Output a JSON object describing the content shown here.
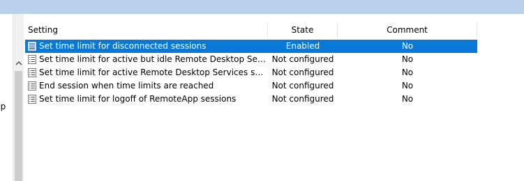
{
  "left_pane": {
    "clipped_text": "pp"
  },
  "table": {
    "columns": {
      "setting": "Setting",
      "state": "State",
      "comment": "Comment"
    },
    "rows": [
      {
        "name": "Set time limit for disconnected sessions",
        "state": "Enabled",
        "comment": "No",
        "selected": true
      },
      {
        "name": "Set time limit for active but idle Remote Desktop Services se...",
        "state": "Not configured",
        "comment": "No",
        "selected": false
      },
      {
        "name": "Set time limit for active Remote Desktop Services sessions",
        "state": "Not configured",
        "comment": "No",
        "selected": false
      },
      {
        "name": "End session when time limits are reached",
        "state": "Not configured",
        "comment": "No",
        "selected": false
      },
      {
        "name": "Set time limit for logoff of RemoteApp sessions",
        "state": "Not configured",
        "comment": "No",
        "selected": false
      }
    ]
  },
  "icons": {
    "policy_setting": "policy-setting-icon",
    "scroll_up": "chevron-up-icon"
  },
  "colors": {
    "selection": "#0a78d7",
    "titlebar": "#b9d1ea"
  }
}
